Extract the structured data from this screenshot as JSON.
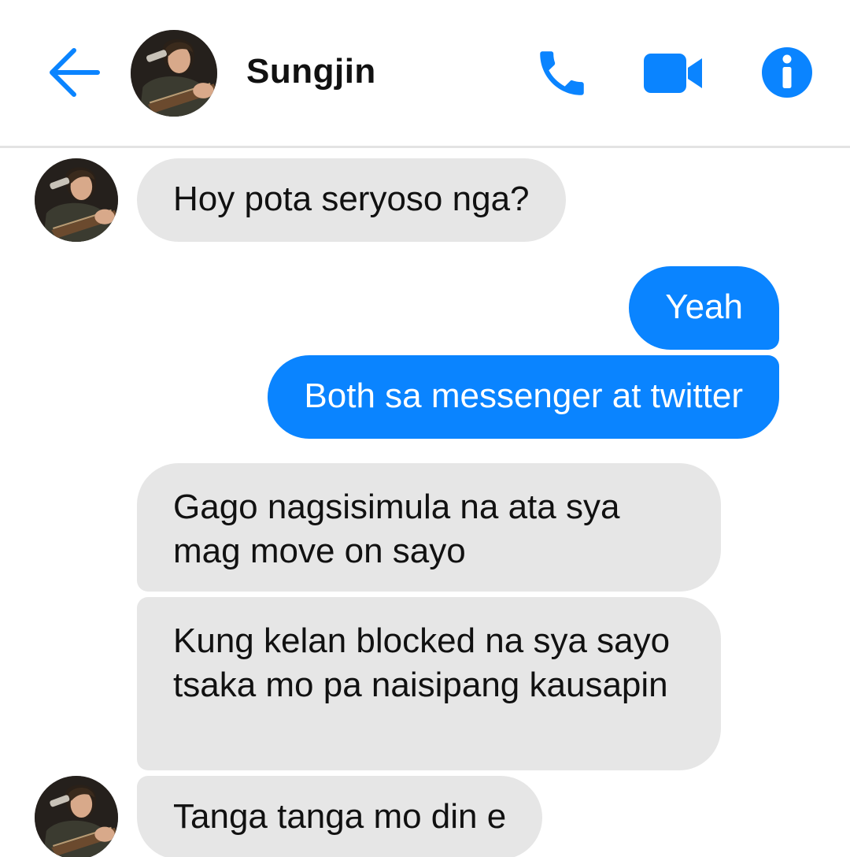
{
  "header": {
    "contact_name": "Sungjin",
    "icons": {
      "back": "back-arrow-icon",
      "call": "phone-icon",
      "video": "video-camera-icon",
      "info": "info-icon"
    }
  },
  "colors": {
    "accent": "#0a84ff",
    "incoming_bubble": "#e6e6e6",
    "outgoing_text": "#ffffff",
    "divider": "#e3e3e3"
  },
  "messages": [
    {
      "direction": "incoming",
      "text": "Hoy pota seryoso nga?"
    },
    {
      "direction": "outgoing",
      "text": "Yeah"
    },
    {
      "direction": "outgoing",
      "text": "Both sa messenger at twitter"
    },
    {
      "direction": "incoming",
      "text": "Gago nagsisimula na ata sya mag move on sayo"
    },
    {
      "direction": "incoming",
      "text": "Kung kelan blocked na sya sayo tsaka mo pa naisipang kausapin"
    },
    {
      "direction": "incoming",
      "text": "Tanga tanga mo din e"
    }
  ]
}
